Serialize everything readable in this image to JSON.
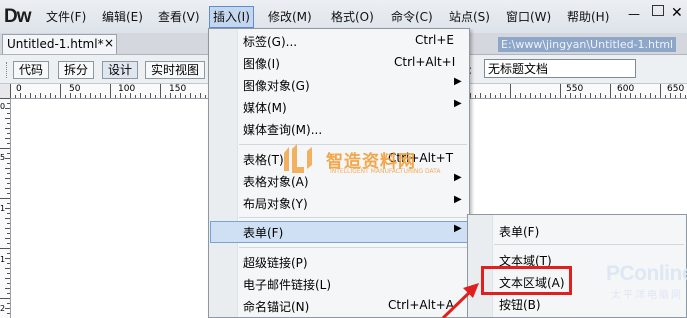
{
  "app": {
    "logo": "Dw"
  },
  "menubar": {
    "items": [
      "文件(F)",
      "编辑(E)",
      "查看(V)",
      "插入(I)",
      "修改(M)",
      "格式(O)",
      "命令(C)",
      "站点(S)",
      "窗口(W)",
      "帮助(H)"
    ],
    "active": "插入(I)"
  },
  "document": {
    "tab_label": "Untitled-1.html*",
    "close_glyph": "×",
    "path": "E:\\www\\jingyan\\Untitled-1.html"
  },
  "toolbar": {
    "buttons": [
      "代码",
      "拆分",
      "设计",
      "实时视图"
    ],
    "active": "设计",
    "title_label": "题:",
    "title_value": "无标题文档"
  },
  "ruler": {
    "h_labels": [
      "0",
      "50",
      "100",
      "150",
      "550",
      "600",
      "650"
    ],
    "v_labels": [
      "0",
      "5",
      "1",
      "1",
      "2"
    ]
  },
  "insert_menu": {
    "items": [
      {
        "label": "标签(G)...",
        "shortcut": "Ctrl+E",
        "submenu": false
      },
      {
        "label": "图像(I)",
        "shortcut": "Ctrl+Alt+I",
        "submenu": false
      },
      {
        "label": "图像对象(G)",
        "shortcut": "",
        "submenu": true
      },
      {
        "label": "媒体(M)",
        "shortcut": "",
        "submenu": true
      },
      {
        "label": "媒体查询(M)...",
        "shortcut": "",
        "submenu": false
      },
      {
        "label": "表格(T)",
        "shortcut": "Ctrl+Alt+T",
        "submenu": false
      },
      {
        "label": "表格对象(A)",
        "shortcut": "",
        "submenu": true
      },
      {
        "label": "布局对象(Y)",
        "shortcut": "",
        "submenu": true
      },
      {
        "label": "表单(F)",
        "shortcut": "",
        "submenu": true,
        "highlighted": true
      },
      {
        "label": "超级链接(P)",
        "shortcut": "",
        "submenu": false
      },
      {
        "label": "电子邮件链接(L)",
        "shortcut": "",
        "submenu": false
      },
      {
        "label": "命名锚记(N)",
        "shortcut": "Ctrl+Alt+A",
        "submenu": false
      }
    ],
    "arrow_glyph": "▶"
  },
  "form_submenu": {
    "items": [
      "表单(F)",
      "文本域(T)",
      "文本区域(A)",
      "按钮(B)"
    ],
    "highlighted": "文本区域(A)"
  },
  "annotation": {
    "highlight_color": "#e0201e"
  },
  "watermarks": {
    "title": "智造资料网",
    "subtitle": "INTELLIGENT MANUFACTURING DATA",
    "pconline": "PConline",
    "pconline_sub": "太平洋电脑网"
  },
  "colors": {
    "menu_highlight": "#cfe0f4",
    "menubar_bg": "#e4e8ee",
    "watermark_orange": "#f29a2e"
  }
}
